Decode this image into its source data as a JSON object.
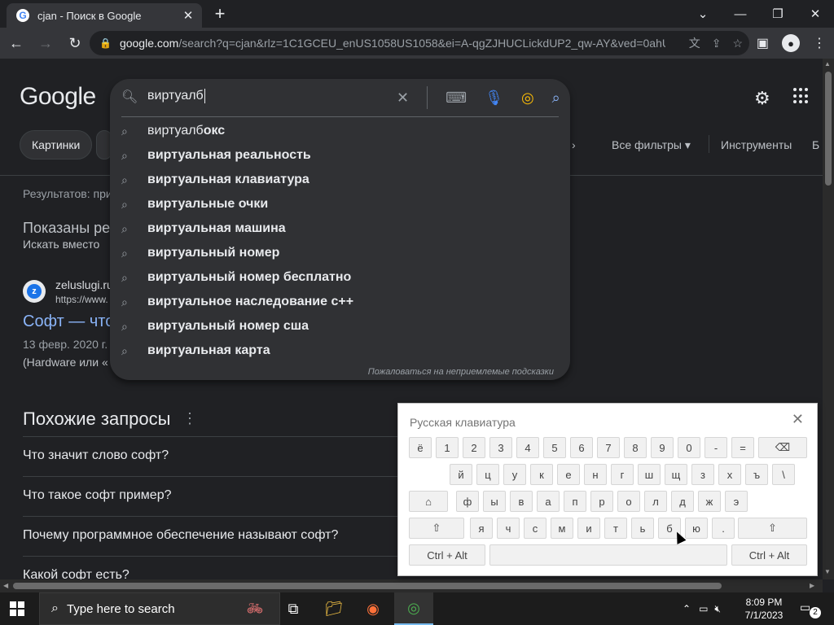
{
  "browser": {
    "tab_title": "cjan - Поиск в Google",
    "favicon_letter": "G",
    "new_tab": "+",
    "url_host": "google.com",
    "url_rest": "/search?q=cjan&rlz=1C1GCEU_enUS1058US1058&ei=A-qgZJHUCLickdUP2_qw-AY&ved=0ahU...",
    "window_controls": [
      "chevron-down",
      "minimize",
      "restore",
      "close"
    ]
  },
  "google": {
    "logo": "Google",
    "query": "виртуалб",
    "suggestions": [
      {
        "prefix": "виртуалб",
        "suffix": "окс"
      },
      {
        "prefix": "",
        "suffix": "виртуальная реальность"
      },
      {
        "prefix": "",
        "suffix": "виртуальная клавиатура"
      },
      {
        "prefix": "",
        "suffix": "виртуальные очки"
      },
      {
        "prefix": "",
        "suffix": "виртуальная машина"
      },
      {
        "prefix": "",
        "suffix": "виртуальный номер"
      },
      {
        "prefix": "",
        "suffix": "виртуальный номер бесплатно"
      },
      {
        "prefix": "",
        "suffix": "виртуальное наследование c++"
      },
      {
        "prefix": "",
        "suffix": "виртуальный номер сша"
      },
      {
        "prefix": "",
        "suffix": "виртуальная карта"
      }
    ],
    "report_link": "Пожаловаться на неприемлемые подсказки",
    "filters": {
      "chip_images": "Картинки",
      "all_filters": "Все фильтры",
      "tools": "Инструменты",
      "cut_letter": "Б"
    },
    "results_count": "Результатов: при",
    "showing": "Показаны ре",
    "instead": "Искать вместо",
    "result": {
      "site_name": "zeluslugi.ru",
      "site_url": "https://www.",
      "title": "Софт — что",
      "date": "13 февр. 2020 г.",
      "snippet": "(Hardware или «"
    },
    "related": {
      "title": "Похожие запросы",
      "items": [
        "Что значит слово софт?",
        "Что такое софт пример?",
        "Почему программное обеспечение называют софт?",
        "Какой софт есть?"
      ]
    }
  },
  "keyboard": {
    "title": "Русская клавиатура",
    "row1": [
      "ё",
      "1",
      "2",
      "3",
      "4",
      "5",
      "6",
      "7",
      "8",
      "9",
      "0",
      "-",
      "="
    ],
    "row2": [
      "й",
      "ц",
      "у",
      "к",
      "е",
      "н",
      "г",
      "ш",
      "щ",
      "з",
      "х",
      "ъ",
      "\\"
    ],
    "row3": [
      "ф",
      "ы",
      "в",
      "а",
      "п",
      "р",
      "о",
      "л",
      "д",
      "ж",
      "э"
    ],
    "row4": [
      "я",
      "ч",
      "с",
      "м",
      "и",
      "т",
      "ь",
      "б",
      "ю",
      "."
    ],
    "ctrl_alt": "Ctrl + Alt",
    "backspace": "⌫",
    "shift": "⇧",
    "home": "⌂"
  },
  "taskbar": {
    "search_placeholder": "Type here to search",
    "time": "8:09 PM",
    "date": "7/1/2023",
    "notifications": "2"
  },
  "colors": {
    "page_bg": "#202124",
    "link": "#8ab4f8",
    "text": "#e8eaed"
  }
}
